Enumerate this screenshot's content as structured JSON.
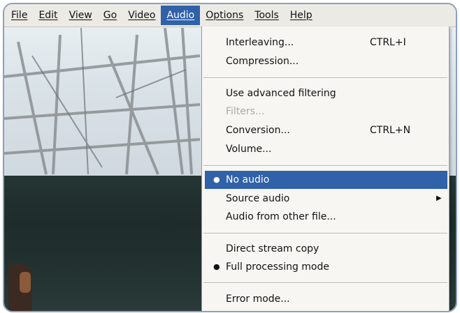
{
  "menubar": {
    "items": [
      {
        "label": "File"
      },
      {
        "label": "Edit"
      },
      {
        "label": "View"
      },
      {
        "label": "Go"
      },
      {
        "label": "Video"
      },
      {
        "label": "Audio"
      },
      {
        "label": "Options"
      },
      {
        "label": "Tools"
      },
      {
        "label": "Help"
      }
    ],
    "active": "Audio"
  },
  "audio_menu": {
    "interleaving": {
      "label": "Interleaving...",
      "shortcut": "CTRL+I"
    },
    "compression": {
      "label": "Compression..."
    },
    "advanced_filtering": {
      "label": "Use advanced filtering"
    },
    "filters": {
      "label": "Filters...",
      "enabled": false
    },
    "conversion": {
      "label": "Conversion...",
      "shortcut": "CTRL+N"
    },
    "volume": {
      "label": "Volume..."
    },
    "no_audio": {
      "label": "No audio",
      "selected": true,
      "bullet": "●"
    },
    "source_audio": {
      "label": "Source audio",
      "arrow": "▶"
    },
    "audio_other_file": {
      "label": "Audio from other file..."
    },
    "direct_stream_copy": {
      "label": "Direct stream copy"
    },
    "full_processing": {
      "label": "Full processing mode",
      "selected": true,
      "bullet": "●"
    },
    "error_mode": {
      "label": "Error mode..."
    }
  },
  "colors": {
    "highlight": "#3061a9",
    "menu_bg": "#f7f6f2",
    "frame_border": "#8aa0bf"
  }
}
